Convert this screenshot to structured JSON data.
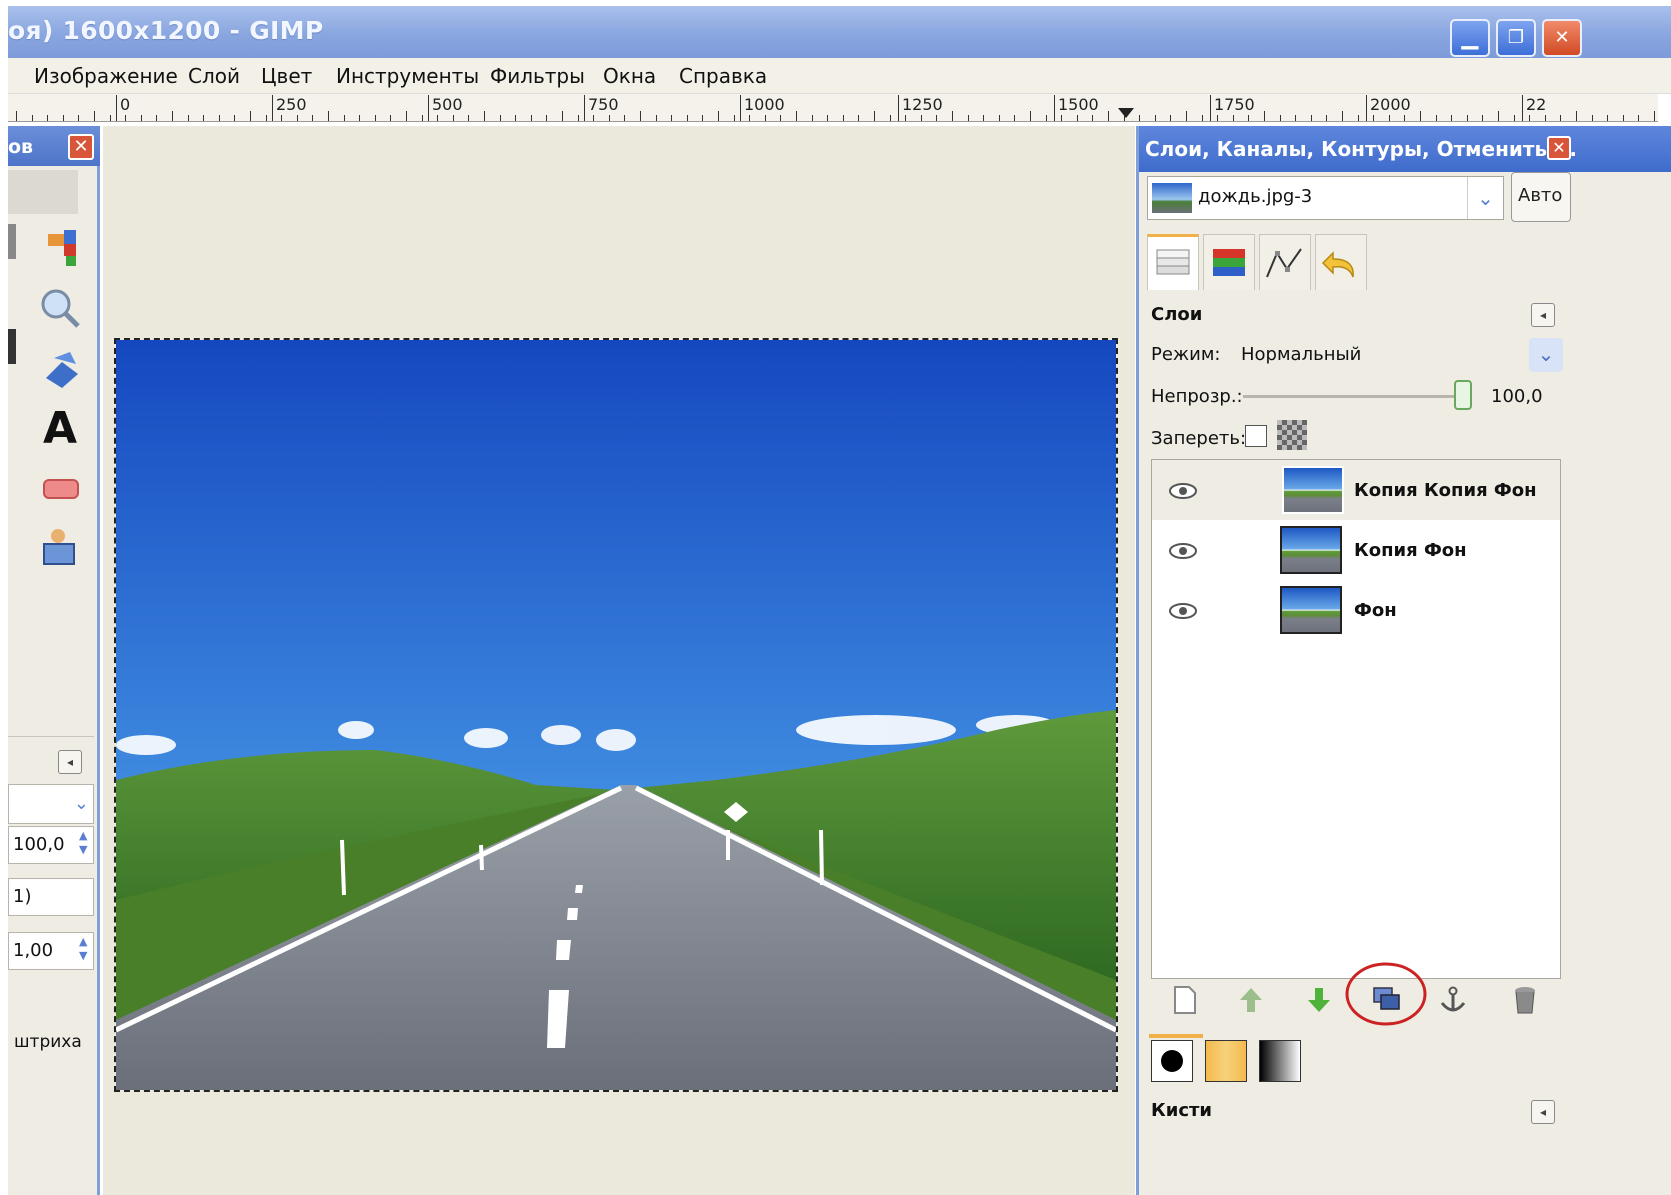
{
  "window": {
    "title": "оя) 1600x1200 - GIMP",
    "controls": {
      "minimize": "▁",
      "maximize": "❐",
      "close": "✕"
    }
  },
  "menu": {
    "items": [
      "Изображение",
      "Слой",
      "Цвет",
      "Инструменты",
      "Фильтры",
      "Окна",
      "Справка"
    ]
  },
  "ruler": {
    "labels": [
      "0",
      "250",
      "500",
      "750",
      "1000",
      "1250",
      "1500",
      "1750",
      "2000",
      "22"
    ]
  },
  "toolbox": {
    "title": "ов",
    "close_label": "✕",
    "tools": [
      "color-tool-icon",
      "zoom-icon",
      "transform-icon",
      "text-tool-icon",
      "eraser-icon",
      "clone-icon"
    ],
    "text_tool_label": "A",
    "options": {
      "opacity_value": "100,0",
      "field2_value": "1)",
      "field3_value": "1,00",
      "stroke_label": "штриха"
    }
  },
  "dock": {
    "title": "Слои, Каналы, Контуры, Отменить ...",
    "close_label": "✕",
    "image_selector": "дождь.jpg-3",
    "auto_button": "Авто",
    "tab_icons": [
      "layers-tab-icon",
      "channels-tab-icon",
      "paths-tab-icon",
      "undo-tab-icon"
    ],
    "layers_panel": {
      "heading": "Слои",
      "mode_label": "Режим:",
      "mode_value": "Нормальный",
      "opacity_label": "Непрозр.:",
      "opacity_value": "100,0",
      "opacity_fraction": 1.0,
      "lock_label": "Запереть:",
      "layers": [
        {
          "name": "Копия Копия Фон",
          "visible": true,
          "selected": true
        },
        {
          "name": "Копия Фон",
          "visible": true,
          "selected": false
        },
        {
          "name": "Фон",
          "visible": true,
          "selected": false
        }
      ],
      "bottom_buttons": [
        "new-layer-icon",
        "raise-layer-icon",
        "lower-layer-icon",
        "duplicate-layer-icon",
        "anchor-layer-icon",
        "delete-layer-icon"
      ],
      "highlighted_button": "duplicate-layer-icon"
    },
    "brushes_label": "Кисти",
    "colors": {
      "accent": "#7f9fd8",
      "highlight_circle": "#cc2222"
    }
  }
}
